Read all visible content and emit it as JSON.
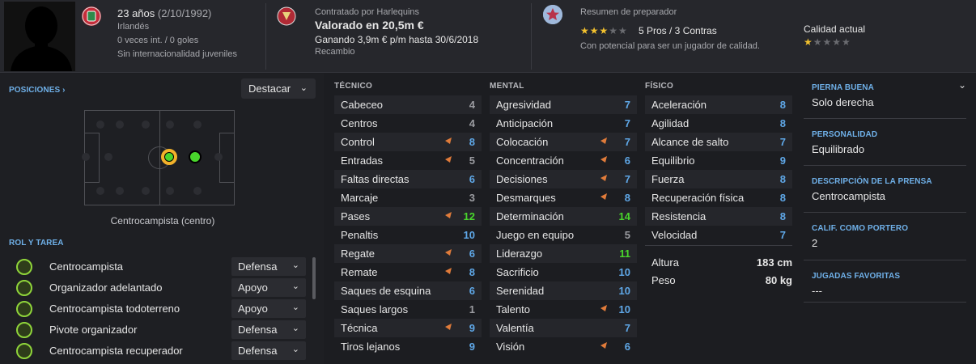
{
  "header": {
    "age": "23 años",
    "dob": "(2/10/1992)",
    "nationality": "Irlandés",
    "caps": "0 veces int. / 0 goles",
    "youth": "Sin internacionalidad juveniles",
    "contract_label": "Contratado por Harlequins",
    "value": "Valorado en 20,5m €",
    "wage": "Ganando 3,9m € p/m hasta 30/6/2018",
    "role_status": "Recambio",
    "coach_label": "Resumen de preparador",
    "pros_cons": "5 Pros / 3 Contras",
    "potential": "Con potencial para ser un jugador de calidad.",
    "quality_label": "Calidad actual",
    "coach_stars": 3,
    "quality_stars": 1
  },
  "positions": {
    "label": "POSICIONES ›",
    "highlight": "Destacar",
    "position_name": "Centrocampista (centro)"
  },
  "roles": {
    "label": "ROL Y TAREA",
    "items": [
      {
        "name": "Centrocampista",
        "duty": "Defensa"
      },
      {
        "name": "Organizador adelantado",
        "duty": "Apoyo"
      },
      {
        "name": "Centrocampista todoterreno",
        "duty": "Apoyo"
      },
      {
        "name": "Pivote organizador",
        "duty": "Defensa"
      },
      {
        "name": "Centrocampista recuperador",
        "duty": "Defensa"
      }
    ]
  },
  "technical": {
    "title": "TÉCNICO",
    "rows": [
      {
        "name": "Cabeceo",
        "value": "4",
        "arrow": false
      },
      {
        "name": "Centros",
        "value": "4",
        "arrow": false
      },
      {
        "name": "Control",
        "value": "8",
        "arrow": true
      },
      {
        "name": "Entradas",
        "value": "5",
        "arrow": true
      },
      {
        "name": "Faltas directas",
        "value": "6",
        "arrow": false
      },
      {
        "name": "Marcaje",
        "value": "3",
        "arrow": false
      },
      {
        "name": "Pases",
        "value": "12",
        "arrow": true
      },
      {
        "name": "Penaltis",
        "value": "10",
        "arrow": false
      },
      {
        "name": "Regate",
        "value": "6",
        "arrow": true
      },
      {
        "name": "Remate",
        "value": "8",
        "arrow": true
      },
      {
        "name": "Saques de esquina",
        "value": "6",
        "arrow": false
      },
      {
        "name": "Saques largos",
        "value": "1",
        "arrow": false
      },
      {
        "name": "Técnica",
        "value": "9",
        "arrow": true
      },
      {
        "name": "Tiros lejanos",
        "value": "9",
        "arrow": false
      }
    ]
  },
  "mental": {
    "title": "MENTAL",
    "rows": [
      {
        "name": "Agresividad",
        "value": "7",
        "arrow": false
      },
      {
        "name": "Anticipación",
        "value": "7",
        "arrow": false
      },
      {
        "name": "Colocación",
        "value": "7",
        "arrow": true
      },
      {
        "name": "Concentración",
        "value": "6",
        "arrow": true
      },
      {
        "name": "Decisiones",
        "value": "7",
        "arrow": true
      },
      {
        "name": "Desmarques",
        "value": "8",
        "arrow": true
      },
      {
        "name": "Determinación",
        "value": "14",
        "arrow": false
      },
      {
        "name": "Juego en equipo",
        "value": "5",
        "arrow": false
      },
      {
        "name": "Liderazgo",
        "value": "11",
        "arrow": false
      },
      {
        "name": "Sacrificio",
        "value": "10",
        "arrow": false
      },
      {
        "name": "Serenidad",
        "value": "10",
        "arrow": false
      },
      {
        "name": "Talento",
        "value": "10",
        "arrow": true
      },
      {
        "name": "Valentía",
        "value": "7",
        "arrow": false
      },
      {
        "name": "Visión",
        "value": "6",
        "arrow": true
      }
    ]
  },
  "physical": {
    "title": "FÍSICO",
    "rows": [
      {
        "name": "Aceleración",
        "value": "8",
        "arrow": false
      },
      {
        "name": "Agilidad",
        "value": "8",
        "arrow": false
      },
      {
        "name": "Alcance de salto",
        "value": "7",
        "arrow": false
      },
      {
        "name": "Equilibrio",
        "value": "9",
        "arrow": false
      },
      {
        "name": "Fuerza",
        "value": "8",
        "arrow": false
      },
      {
        "name": "Recuperación física",
        "value": "8",
        "arrow": false
      },
      {
        "name": "Resistencia",
        "value": "8",
        "arrow": false
      },
      {
        "name": "Velocidad",
        "value": "7",
        "arrow": false
      }
    ],
    "height_label": "Altura",
    "height": "183 cm",
    "weight_label": "Peso",
    "weight": "80 kg"
  },
  "info": [
    {
      "label": "PIERNA BUENA",
      "value": "Solo derecha"
    },
    {
      "label": "PERSONALIDAD",
      "value": "Equilibrado"
    },
    {
      "label": "DESCRIPCIÓN DE LA PRENSA",
      "value": "Centrocampista"
    },
    {
      "label": "CALIF. COMO PORTERO",
      "value": "2"
    },
    {
      "label": "JUGADAS FAVORITAS",
      "value": "---"
    }
  ],
  "colors": {
    "grey": "#9b9ca1",
    "white": "#e6e6e6",
    "blue": "#5fa8e8",
    "green": "#49d62c",
    "accent": "#e07b3a"
  }
}
